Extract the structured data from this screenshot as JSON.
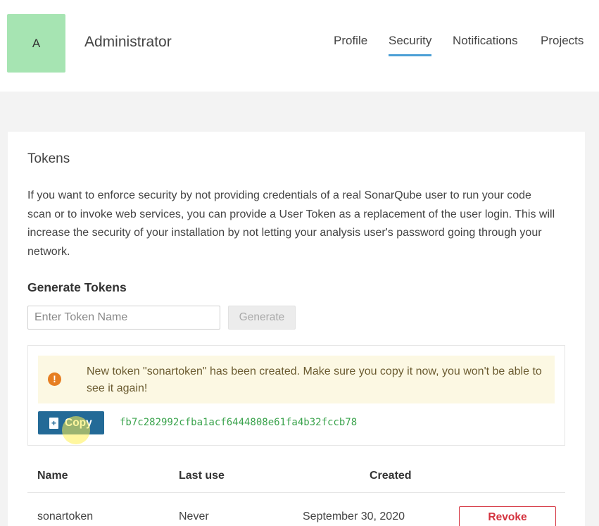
{
  "user": {
    "avatar_letter": "A",
    "name": "Administrator"
  },
  "nav": {
    "items": [
      {
        "label": "Profile"
      },
      {
        "label": "Security"
      },
      {
        "label": "Notifications"
      },
      {
        "label": "Projects"
      }
    ],
    "active": "Security",
    "accent_color": "#4b9fd5"
  },
  "tokens_section": {
    "title": "Tokens",
    "description": "If you want to enforce security by not providing credentials of a real SonarQube user to run your code scan or to invoke web services, you can provide a User Token as a replacement of the user login. This will increase the security of your installation by not letting your analysis user's password going through your network."
  },
  "generate": {
    "title": "Generate Tokens",
    "input_placeholder": "Enter Token Name",
    "input_value": "",
    "button_label": "Generate"
  },
  "new_token": {
    "alert_icon": "exclamation-circle-icon",
    "alert_text": "New token \"sonartoken\" has been created. Make sure you copy it now, you won't be able to see it again!",
    "copy_label": "Copy",
    "copy_icon": "copy-file-icon",
    "value": "fb7c282992cfba1acf6444808e61fa4b32fccb78",
    "value_color": "#3aa34c"
  },
  "table": {
    "headers": [
      "Name",
      "Last use",
      "Created"
    ],
    "rows": [
      {
        "name": "sonartoken",
        "last_use": "Never",
        "created": "September 30, 2020",
        "action": "Revoke"
      }
    ]
  },
  "colors": {
    "avatar": "#a6e4b2",
    "copy_button": "#236a97",
    "revoke": "#d4333f",
    "alert_bg": "#fcf8e3",
    "alert_icon": "#e67e22"
  }
}
